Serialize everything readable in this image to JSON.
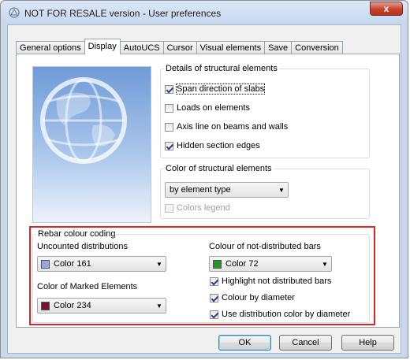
{
  "window": {
    "title": "NOT FOR RESALE version - User preferences",
    "close_label": "x"
  },
  "tabs": [
    "General options",
    "Display",
    "AutoUCS",
    "Cursor",
    "Visual elements",
    "Save",
    "Conversion"
  ],
  "details": {
    "legend": "Details of structural elements",
    "items": [
      {
        "label": "Span direction of slabs",
        "checked": true
      },
      {
        "label": "Loads on elements",
        "checked": false
      },
      {
        "label": "Axis line on beams and walls",
        "checked": false
      },
      {
        "label": "Hidden section edges",
        "checked": true
      }
    ]
  },
  "color_structural": {
    "legend": "Color of structural elements",
    "select_value": "by element type",
    "colors_legend_label": "Colors legend",
    "colors_legend_checked": false
  },
  "rebar": {
    "legend": "Rebar colour coding",
    "uncounted_label": "Uncounted distributions",
    "uncounted_value": "Color 161",
    "uncounted_color": "#8fa8e6",
    "marked_label": "Color of Marked Elements",
    "marked_value": "Color 234",
    "marked_color": "#7a0f38",
    "not_distributed_label": "Colour of not-distributed bars",
    "not_distributed_value": "Color 72",
    "not_distributed_color": "#1e9a1e",
    "checks": [
      {
        "label": "Highlight not distributed bars",
        "checked": true
      },
      {
        "label": "Colour by diameter",
        "checked": true
      },
      {
        "label": "Use distribution color by diameter",
        "checked": true
      }
    ]
  },
  "buttons": {
    "ok": "OK",
    "cancel": "Cancel",
    "help": "Help"
  }
}
